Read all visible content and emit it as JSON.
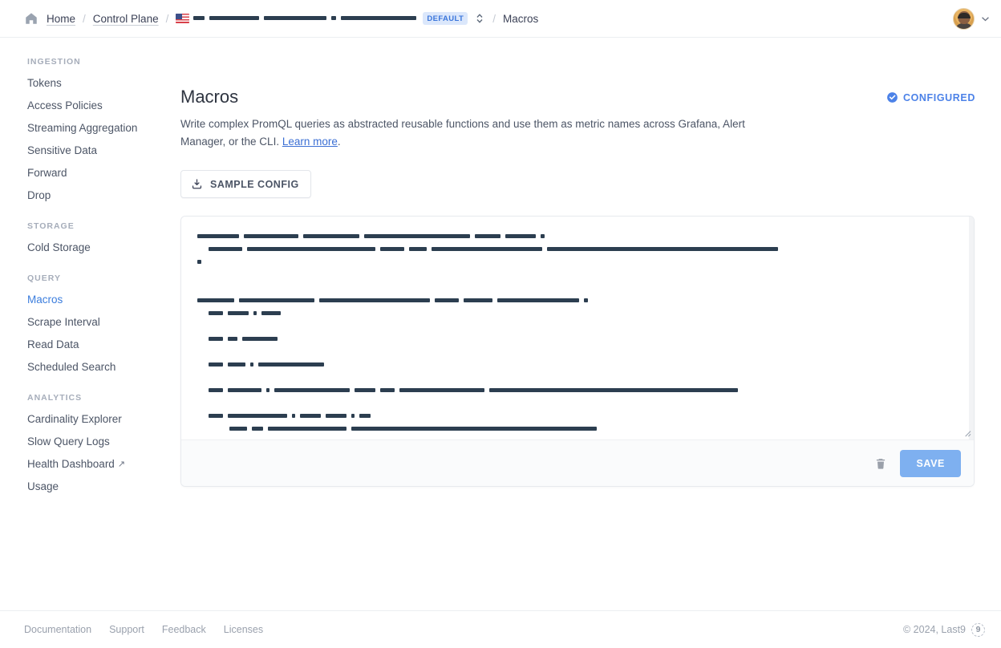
{
  "topbar": {
    "home_label": "Home",
    "control_plane_label": "Control Plane",
    "separator": "/",
    "cluster": {
      "flag_icon": "us-flag-icon",
      "name_redacted": true,
      "redaction_segments": [
        14,
        62,
        78,
        6,
        94
      ],
      "badge_label": "DEFAULT",
      "stepper_icon": "chevron-up-down-icon"
    },
    "current_page": "Macros",
    "avatar_icon": "user-avatar",
    "account_chevron_icon": "chevron-down-icon"
  },
  "sidebar": {
    "groups": [
      {
        "title": "INGESTION",
        "items": [
          {
            "label": "Tokens",
            "active": false
          },
          {
            "label": "Access Policies",
            "active": false
          },
          {
            "label": "Streaming Aggregation",
            "active": false
          },
          {
            "label": "Sensitive Data",
            "active": false
          },
          {
            "label": "Forward",
            "active": false
          },
          {
            "label": "Drop",
            "active": false
          }
        ]
      },
      {
        "title": "STORAGE",
        "items": [
          {
            "label": "Cold Storage",
            "active": false
          }
        ]
      },
      {
        "title": "QUERY",
        "items": [
          {
            "label": "Macros",
            "active": true
          },
          {
            "label": "Scrape Interval",
            "active": false
          },
          {
            "label": "Read Data",
            "active": false
          },
          {
            "label": "Scheduled Search",
            "active": false
          }
        ]
      },
      {
        "title": "ANALYTICS",
        "items": [
          {
            "label": "Cardinality Explorer",
            "active": false
          },
          {
            "label": "Slow Query Logs",
            "active": false
          },
          {
            "label": "Health Dashboard",
            "active": false,
            "external": true,
            "external_icon": "external-link-arrow"
          },
          {
            "label": "Usage",
            "active": false
          }
        ]
      }
    ]
  },
  "main": {
    "title": "Macros",
    "description_before_link": "Write complex PromQL queries as abstracted reusable functions and use them as metric names across Grafana, Alert Manager, or the CLI. ",
    "description_link": "Learn more",
    "description_after_link": ".",
    "status": {
      "label": "CONFIGURED",
      "icon": "check-circle-icon",
      "color": "#4c82e8"
    },
    "sample_config_button": {
      "label": "SAMPLE CONFIG",
      "icon": "download-icon"
    },
    "editor": {
      "content_redacted": true,
      "redaction_color": "#2c3e50",
      "resize_grip_icon": "resize-handle-icon",
      "lines": [
        {
          "indent": 0,
          "segments": [
            52,
            68,
            70,
            132,
            32,
            38,
            5
          ]
        },
        {
          "indent": 14,
          "segments": [
            42,
            160,
            30,
            22,
            138,
            288
          ]
        },
        {
          "indent": 0,
          "segments": [
            5
          ]
        },
        {
          "indent": 0,
          "segments": []
        },
        {
          "indent": 0,
          "segments": []
        },
        {
          "indent": 0,
          "segments": [
            46,
            94,
            138,
            30,
            36,
            102,
            5
          ]
        },
        {
          "indent": 14,
          "segments": [
            18,
            26,
            4,
            24
          ]
        },
        {
          "indent": 0,
          "segments": []
        },
        {
          "indent": 14,
          "segments": [
            18,
            12,
            44
          ]
        },
        {
          "indent": 0,
          "segments": []
        },
        {
          "indent": 14,
          "segments": [
            18,
            22,
            4,
            82
          ]
        },
        {
          "indent": 0,
          "segments": []
        },
        {
          "indent": 14,
          "segments": [
            18,
            42,
            4,
            94,
            26,
            18,
            106,
            310
          ]
        },
        {
          "indent": 0,
          "segments": []
        },
        {
          "indent": 14,
          "segments": [
            18,
            74,
            4,
            26,
            26,
            4,
            14
          ]
        },
        {
          "indent": 40,
          "segments": [
            22,
            14,
            98,
            306
          ]
        }
      ],
      "delete_icon": "trash-icon",
      "save_label": "SAVE"
    }
  },
  "footer": {
    "links": [
      "Documentation",
      "Support",
      "Feedback",
      "Licenses"
    ],
    "copyright": "© 2024, Last9",
    "logo_text": "9"
  }
}
